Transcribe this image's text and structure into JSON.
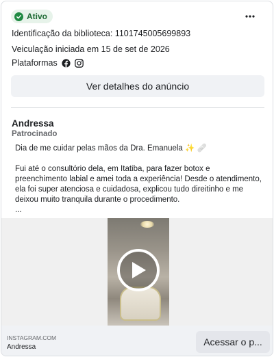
{
  "status": {
    "label": "Ativo",
    "color": "#1f8a42"
  },
  "more_menu": {
    "icon": "more-horizontal-icon"
  },
  "library_id": "Identificação da biblioteca: 1101745005699893",
  "run_dates": "Veiculação iniciada em 15 de set de 2026",
  "platforms": {
    "label": "Plataformas",
    "icons": [
      "facebook-icon",
      "instagram-icon"
    ]
  },
  "details_button": "Ver detalhes do anúncio",
  "ad": {
    "advertiser": "Andressa",
    "sponsored": "Patrocinado",
    "text_line1": "Dia de me cuidar pelas mãos da Dra. Emanuela ✨ 🩹",
    "text_para2": "Fui até o consultório dela, em Itatiba, para fazer botox e preenchimento labial e amei toda a experiência! Desde o atendimento, ela foi super atenciosa e cuidadosa, explicou tudo direitinho e me deixou muito tranquila durante o procedimento.",
    "text_more": "..."
  },
  "footer": {
    "domain": "INSTAGRAM.COM",
    "name": "Andressa",
    "cta": "Acessar o p..."
  }
}
